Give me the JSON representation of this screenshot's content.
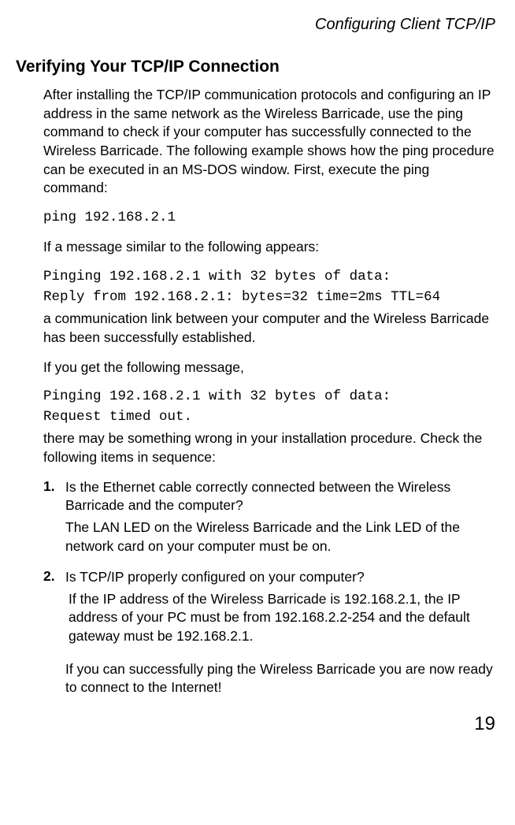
{
  "header": {
    "running_title": "Configuring Client TCP/IP"
  },
  "section": {
    "heading": "Verifying Your TCP/IP Connection",
    "intro": "After installing the TCP/IP communication protocols and configuring an IP address in the same network as the Wireless Barricade, use the ping command to check if your computer has successfully connected to the Wireless Barricade. The following example shows how the ping procedure can be executed in an MS-DOS window. First, execute the ping command:",
    "code1": "ping 192.168.2.1",
    "para2": "If a message similar to the following appears:",
    "code2a": "Pinging 192.168.2.1 with 32 bytes of data:",
    "code2b": "Reply from 192.168.2.1: bytes=32 time=2ms TTL=64",
    "para3": "a communication link between your computer and the Wireless Barricade has been successfully established.",
    "para4": "If you get the following message,",
    "code3a": "Pinging 192.168.2.1 with 32 bytes of data:",
    "code3b": "Request timed out.",
    "para5": "there may be something wrong in your installation procedure. Check the following items in sequence:",
    "list": [
      {
        "num": "1.",
        "q": "Is the Ethernet cable correctly connected between the Wireless Barricade and the computer?",
        "a": "The LAN LED on the Wireless Barricade and the Link LED of the network card on your computer must be on."
      },
      {
        "num": "2.",
        "q": "Is TCP/IP properly configured on your computer?",
        "a": "If the IP address of the Wireless Barricade is 192.168.2.1, the IP address of your PC must be from 192.168.2.2-254 and the default gateway must be 192.168.2.1.",
        "closing": "If you can successfully ping the Wireless Barricade you are now ready to connect to the Internet!"
      }
    ]
  },
  "page_number": "19"
}
